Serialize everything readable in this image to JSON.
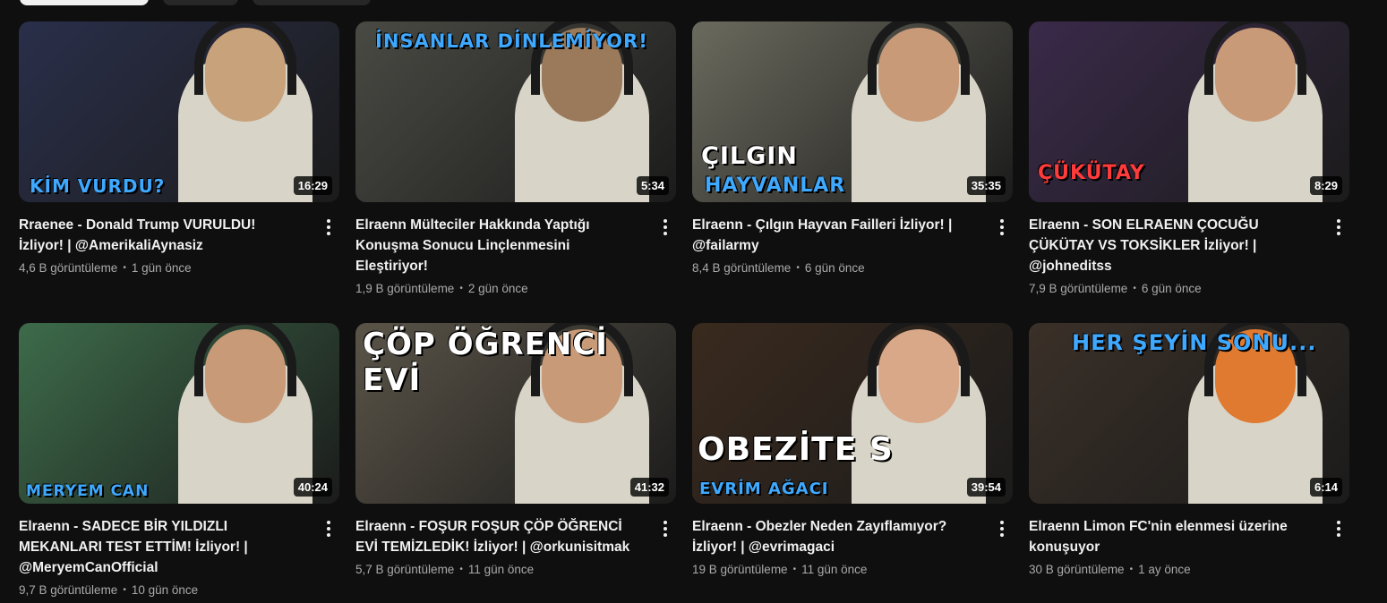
{
  "videos": [
    {
      "title": "Rraenee - Donald Trump VURULDU! İzliyor! | @AmerikaliAynasiz",
      "views": "4,6 B görüntüleme",
      "age": "1 gün önce",
      "duration": "16:29",
      "overlay": "KİM VURDU?",
      "overlay_color": "#3fa9ff",
      "bg": "#2a2f4a",
      "accent": "#c8a27a"
    },
    {
      "title": "Elraenn Mülteciler Hakkında Yaptığı Konuşma Sonucu Linçlenmesini Eleştiriyor!",
      "views": "1,9 B görüntüleme",
      "age": "2 gün önce",
      "duration": "5:34",
      "overlay": "İNSANLAR DİNLEMİYOR!",
      "overlay_color": "#3fa9ff",
      "bg": "#4a4a44",
      "accent": "#9a7a5a"
    },
    {
      "title": "Elraenn - Çılgın Hayvan Failleri İzliyor! | @failarmy",
      "views": "8,4 B görüntüleme",
      "age": "6 gün önce",
      "duration": "35:35",
      "overlay": "ÇILGIN",
      "overlay2": "HAYVANLAR",
      "overlay_color": "#ffffff",
      "overlay2_color": "#3fa9ff",
      "bg": "#6b6a5e",
      "accent": "#c89a78"
    },
    {
      "title": "Elraenn - SON ELRAENN ÇOCUĞU ÇÜKÜTAY VS TOKSİKLER İzliyor! | @johneditss",
      "views": "7,9 B görüntüleme",
      "age": "6 gün önce",
      "duration": "8:29",
      "overlay": "ÇÜKÜTAY",
      "overlay_color": "#ff3b3b",
      "bg": "#3a2a4a",
      "accent": "#c89a78"
    },
    {
      "title": "Elraenn - SADECE BİR YILDIZLI MEKANLARI TEST ETTİM! İzliyor! | @MeryemCanOfficial",
      "views": "9,7 B görüntüleme",
      "age": "10 gün önce",
      "duration": "40:24",
      "overlay": "MERYEM CAN",
      "overlay_color": "#3fa9ff",
      "bg": "#3d6b4a",
      "accent": "#c89a78"
    },
    {
      "title": "Elraenn - FOŞUR FOŞUR ÇÖP ÖĞRENCİ EVİ TEMİZLEDİK! İzliyor! | @orkunisitmak",
      "views": "5,7 B görüntüleme",
      "age": "11 gün önce",
      "duration": "41:32",
      "overlay": "ÇÖP ÖĞRENCİ EVİ",
      "overlay_color": "#ffffff",
      "bg": "#5a5448",
      "accent": "#c89a78"
    },
    {
      "title": "Elraenn - Obezler Neden Zayıflamıyor? İzliyor! | @evrimagaci",
      "views": "19 B görüntüleme",
      "age": "11 gün önce",
      "duration": "39:54",
      "overlay": "OBEZİTE S",
      "overlay2": "EVRİM AĞACI",
      "overlay_color": "#ffffff",
      "overlay2_color": "#3fa9ff",
      "bg": "#3a2a1e",
      "accent": "#d8a888"
    },
    {
      "title": "Elraenn Limon FC'nin elenmesi üzerine konuşuyor",
      "views": "30 B görüntüleme",
      "age": "1 ay önce",
      "duration": "6:14",
      "overlay": "HER ŞEYİN SONU...",
      "overlay_color": "#3fa9ff",
      "bg": "#3a3028",
      "accent": "#e07a30"
    }
  ]
}
